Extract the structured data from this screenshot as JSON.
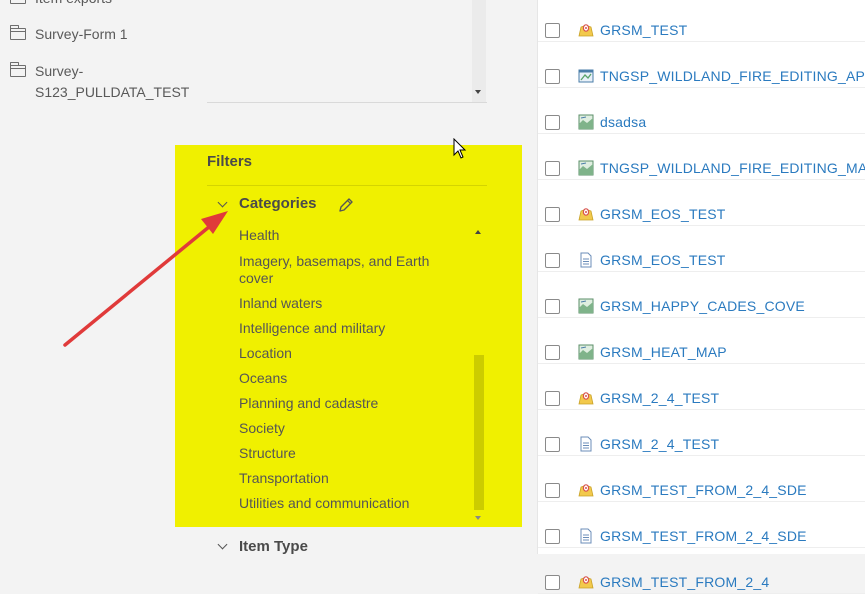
{
  "folders": {
    "items": [
      {
        "label": "Item exports"
      },
      {
        "label": "Survey-Form 1"
      },
      {
        "label": "Survey-",
        "label2": "S123_PULLDATA_TEST"
      }
    ]
  },
  "filters": {
    "title": "Filters",
    "categories": {
      "title": "Categories",
      "items": [
        "Health",
        "Imagery, basemaps, and Earth cover",
        "Inland waters",
        "Intelligence and military",
        "Location",
        "Oceans",
        "Planning and cadastre",
        "Society",
        "Structure",
        "Transportation",
        "Utilities and communication"
      ]
    },
    "item_type": {
      "title": "Item Type"
    }
  },
  "content": {
    "rows": [
      {
        "title": "GRSM_TEST",
        "icon": "survey-icon"
      },
      {
        "title": "TNGSP_WILDLAND_FIRE_EDITING_APPLI",
        "icon": "web-app-icon"
      },
      {
        "title": "dsadsa",
        "icon": "web-map-icon"
      },
      {
        "title": "TNGSP_WILDLAND_FIRE_EDITING_MAP",
        "icon": "web-map-icon"
      },
      {
        "title": "GRSM_EOS_TEST",
        "icon": "survey-icon"
      },
      {
        "title": "GRSM_EOS_TEST",
        "icon": "form-icon"
      },
      {
        "title": "GRSM_HAPPY_CADES_COVE",
        "icon": "web-map-icon"
      },
      {
        "title": "GRSM_HEAT_MAP",
        "icon": "web-map-icon"
      },
      {
        "title": "GRSM_2_4_TEST",
        "icon": "survey-icon"
      },
      {
        "title": "GRSM_2_4_TEST",
        "icon": "form-icon"
      },
      {
        "title": "GRSM_TEST_FROM_2_4_SDE",
        "icon": "survey-icon"
      },
      {
        "title": "GRSM_TEST_FROM_2_4_SDE",
        "icon": "form-icon"
      },
      {
        "title": "GRSM_TEST_FROM_2_4",
        "icon": "survey-icon"
      }
    ]
  },
  "colors": {
    "highlight": "#f0f000",
    "link": "#2a7abf",
    "annotation_arrow": "#e03a3a"
  }
}
